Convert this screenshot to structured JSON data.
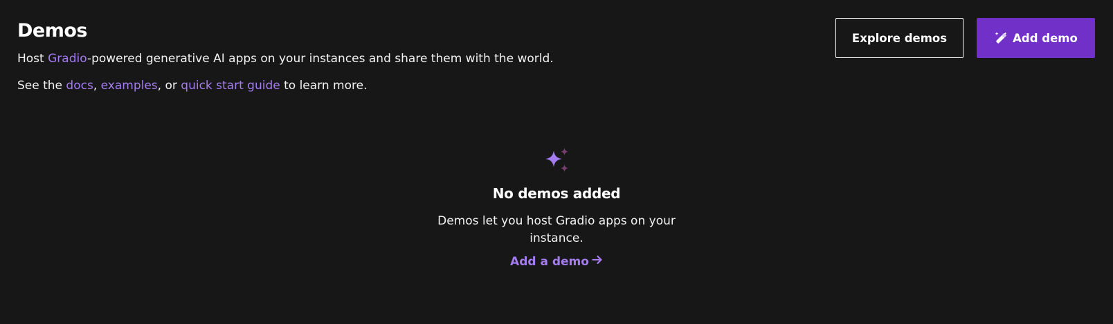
{
  "header": {
    "title": "Demos",
    "line1": {
      "prefix": "Host ",
      "link": "Gradio",
      "suffix": "-powered generative AI apps on your instances and share them with the world."
    },
    "line2": {
      "prefix": "See the ",
      "link_docs": "docs",
      "sep1": ", ",
      "link_examples": "examples",
      "sep2": ", or ",
      "link_guide": "quick start guide",
      "suffix": " to learn more."
    }
  },
  "actions": {
    "explore_label": "Explore demos",
    "add_label": "Add demo",
    "add_icon": "magic-wand-icon"
  },
  "empty_state": {
    "icon": "sparkle-icon",
    "title": "No demos added",
    "text": "Demos let you host Gradio apps on your instance.",
    "link": "Add a demo",
    "link_icon": "arrow-right-icon"
  },
  "colors": {
    "background": "#171717",
    "accent": "#7131c9",
    "link": "#a47cf0",
    "text": "#ffffff"
  }
}
